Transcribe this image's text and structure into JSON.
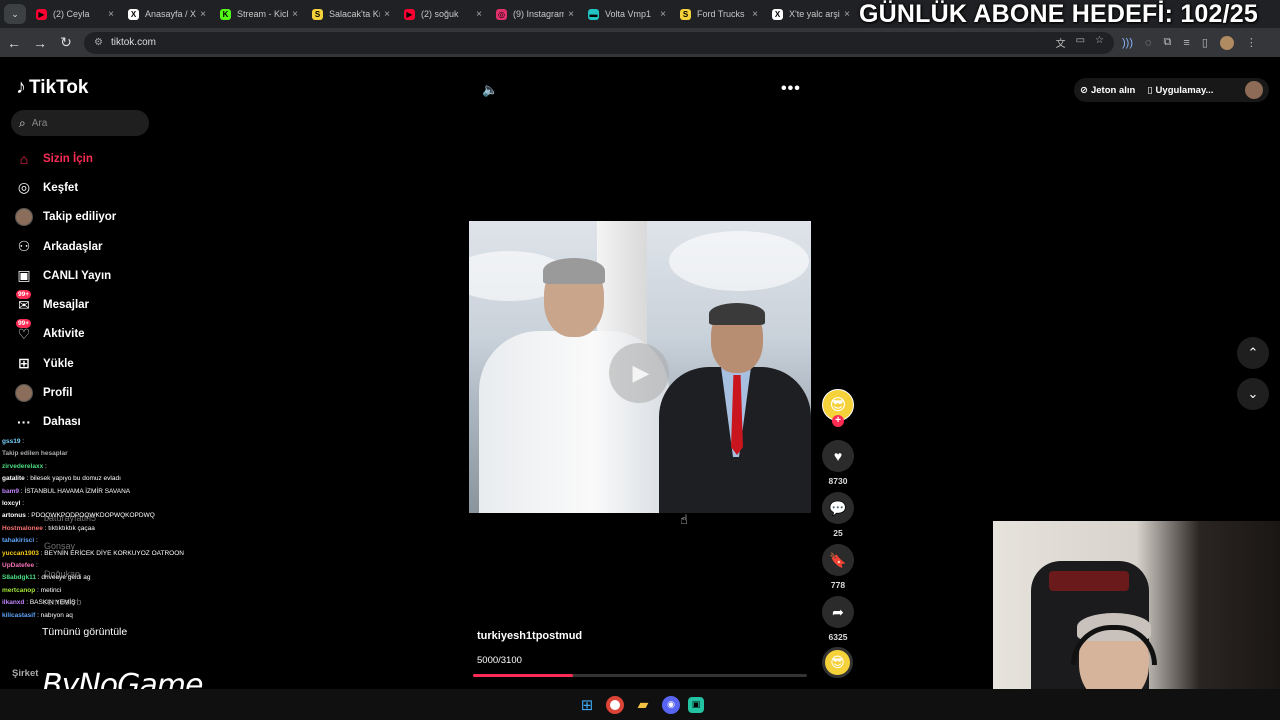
{
  "browser": {
    "tabs": [
      {
        "label": "(2) Ceyla",
        "icon": "youtube-icon",
        "color": "#ff0033",
        "glyph": "▶"
      },
      {
        "label": "Anasayfa / X",
        "icon": "x-icon",
        "color": "#ffffff",
        "glyph": "X"
      },
      {
        "label": "Stream - Kick",
        "icon": "kick-icon",
        "color": "#53fc18",
        "glyph": "K"
      },
      {
        "label": "Salacak'ta Kı",
        "icon": "s-icon",
        "color": "#f5d23a",
        "glyph": "S"
      },
      {
        "label": "(2) soğuk",
        "icon": "youtube-icon",
        "color": "#ff0033",
        "glyph": "▶"
      },
      {
        "label": "(9) Instagram",
        "icon": "instagram-icon",
        "color": "#e1306c",
        "glyph": "◎"
      },
      {
        "label": "Volta Vmp1",
        "icon": "volta-icon",
        "color": "#22c3c3",
        "glyph": "▬"
      },
      {
        "label": "Ford Trucks",
        "icon": "s-icon",
        "color": "#f5d23a",
        "glyph": "S"
      },
      {
        "label": "X'te yalc arşi",
        "icon": "x-icon",
        "color": "#ffffff",
        "glyph": "X"
      }
    ],
    "url": "tiktok.com"
  },
  "overlay": {
    "title": "GÜNLÜK ABONE HEDEFİ: 102/25"
  },
  "tiktok": {
    "logo": "TikTok",
    "search_placeholder": "Ara",
    "nav": [
      {
        "label": "Sizin İçin",
        "icon": "home-icon"
      },
      {
        "label": "Keşfet",
        "icon": "compass-icon"
      },
      {
        "label": "Takip ediliyor",
        "icon": "avatar-icon"
      },
      {
        "label": "Arkadaşlar",
        "icon": "friends-icon"
      },
      {
        "label": "CANLI Yayın",
        "icon": "live-icon"
      },
      {
        "label": "Mesajlar",
        "icon": "message-icon",
        "badge": "99+"
      },
      {
        "label": "Aktivite",
        "icon": "activity-icon",
        "badge": "99+"
      },
      {
        "label": "Yükle",
        "icon": "upload-icon"
      },
      {
        "label": "Profil",
        "icon": "profile-avatar-icon"
      },
      {
        "label": "Dahası",
        "icon": "more-icon"
      }
    ],
    "see_all": "Tümünü görüntüle",
    "company": "Şirket",
    "top_right": {
      "coins": "Jeton alın",
      "app": "Uygulamay..."
    },
    "video": {
      "username": "turkiyesh1tpostmud",
      "description": "5000/3100",
      "progress": 0.3
    },
    "actions": {
      "likes": "8730",
      "comments": "25",
      "saves": "778",
      "shares": "6325"
    }
  },
  "chat": [
    {
      "user": "gss19",
      "msg": ":",
      "color": "#7ad1ff"
    },
    {
      "user": "Takip edilen hesaplar",
      "msg": "",
      "color": "#aaaaaa"
    },
    {
      "user": "zirvederelaxx",
      "msg": ":",
      "color": "#4ade80"
    },
    {
      "user": "gatalite",
      "msg": ": bilesek yapıyo bu domuz evladı",
      "color": "#ffffff"
    },
    {
      "user": "bam9",
      "msg": ": İSTANBUL HAVAMA İZMİR SAVANA",
      "color": "#c084fc"
    },
    {
      "user": "loxcyl",
      "msg": ":",
      "color": "#ffffff"
    },
    {
      "user": "artonus",
      "msg": ": PDOQWKPODPOQWKDOPWQKOPDWQ",
      "color": "#ffffff"
    },
    {
      "user": "Hostmalonee",
      "msg": ": tıktıktıktık çaçaa",
      "color": "#f87171"
    },
    {
      "user": "tahakirisci",
      "msg": ":",
      "color": "#60a5fa"
    },
    {
      "user": "yuccan1903",
      "msg": ": BEYNİN ERİCEK DİYE KORKUYOZ OATROON",
      "color": "#facc15"
    },
    {
      "user": "UpDatefee",
      "msg": ":",
      "color": "#f472b6"
    },
    {
      "user": "S8abdgk11",
      "msg": ": driveeye geldi ag",
      "color": "#4ade80"
    },
    {
      "user": "mertcanop",
      "msg": ": metinci",
      "color": "#a3e635"
    },
    {
      "user": "ilkanxd",
      "msg": ": BASKIN YEMİŞ",
      "color": "#c084fc"
    },
    {
      "user": "kilicastasif",
      "msg": ": nabıyon aq",
      "color": "#60a5fa"
    }
  ],
  "ghost_names": [
    "baturayfatih5",
    "Gonsay",
    "Doğukan",
    "remeskrb"
  ],
  "watermark": "ByNoGame"
}
